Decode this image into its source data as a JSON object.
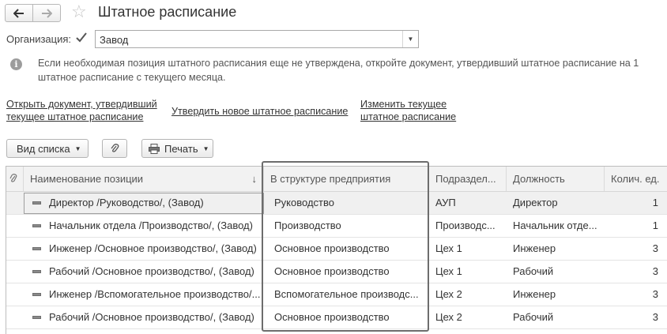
{
  "window": {
    "title": "Штатное расписание"
  },
  "org": {
    "label": "Организация:",
    "checked": true,
    "value": "Завод"
  },
  "info": {
    "text": "Если необходимая позиция штатного расписания еще не утверждена, откройте документ, утвердивший штатное расписание на 1 штатное расписание с текущего месяца."
  },
  "links": {
    "open_doc_line1": "Открыть документ, утвердивший",
    "open_doc_line2": "текущее штатное расписание",
    "approve_new": "Утвердить новое штатное расписание",
    "change_line1": "Изменить текущее",
    "change_line2": "штатное расписание"
  },
  "toolbar": {
    "list_view": "Вид списка",
    "print": "Печать"
  },
  "table": {
    "headers": {
      "name": "Наименование позиции",
      "structure": "В структуре предприятия",
      "dept": "Подраздел...",
      "position": "Должность",
      "count": "Колич. ед."
    },
    "rows": [
      {
        "name": "Директор /Руководство/, (Завод)",
        "structure": "Руководство",
        "dept": "АУП",
        "position": "Директор",
        "count": "1"
      },
      {
        "name": "Начальник отдела /Производство/, (Завод)",
        "structure": "Производство",
        "dept": "Производс...",
        "position": "Начальник отде...",
        "count": "1"
      },
      {
        "name": "Инженер /Основное производство/, (Завод)",
        "structure": "Основное производство",
        "dept": "Цех 1",
        "position": "Инженер",
        "count": "3"
      },
      {
        "name": "Рабочий /Основное производство/, (Завод)",
        "structure": "Основное производство",
        "dept": "Цех 1",
        "position": "Рабочий",
        "count": "3"
      },
      {
        "name": "Инженер /Вспомогательное производство/...",
        "structure": "Вспомогательное производс...",
        "dept": "Цех 2",
        "position": "Инженер",
        "count": "3"
      },
      {
        "name": "Рабочий /Основное производство/, (Завод)",
        "structure": "Основное производство",
        "dept": "Цех 2",
        "position": "Рабочий",
        "count": "3"
      }
    ]
  }
}
